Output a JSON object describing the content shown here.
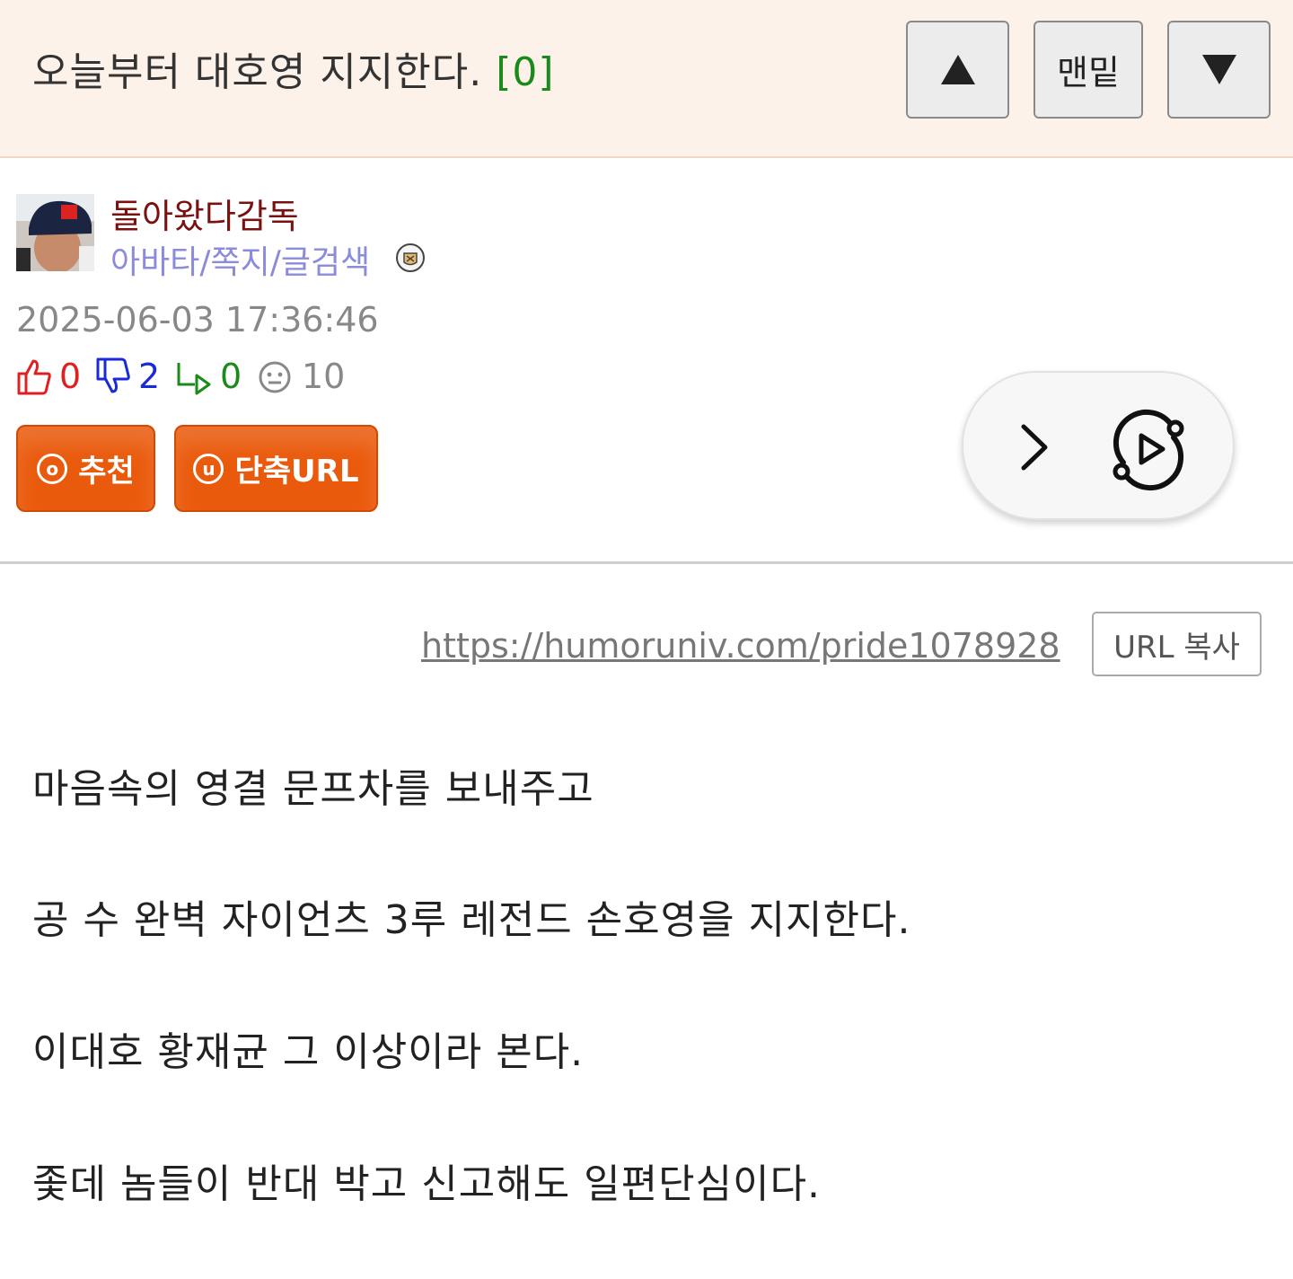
{
  "header": {
    "title": "오늘부터 대호영 지지한다.",
    "comment_count": "[0]",
    "up_icon": "triangle-up-icon",
    "bottom_label": "맨밑",
    "down_icon": "triangle-down-icon"
  },
  "author": {
    "name": "돌아왔다감독",
    "links": "아바타/쪽지/글검색",
    "badge_icon": "member-badge-icon"
  },
  "post": {
    "date": "2025-06-03 17:36:46",
    "stats": {
      "likes": "0",
      "dislikes": "2",
      "replies": "0",
      "views": "10"
    },
    "buttons": {
      "recommend": "추천",
      "recommend_symbol": "o",
      "short_url": "단축URL",
      "short_url_symbol": "u"
    },
    "url": "https://humoruniv.com/pride1078928",
    "copy_label": "URL 복사",
    "body": [
      "마음속의 영결 문프차를 보내주고",
      "공 수 완벽 자이언츠 3루 레전드 손호영을 지지한다.",
      "이대호 황재균 그 이상이라 본다.",
      "좇데 놈들이 반대 박고 신고해도 일편단심이다."
    ]
  },
  "colors": {
    "header_bg": "#fdf2e9",
    "author_name": "#7a1010",
    "author_links": "#8b8bdc",
    "like": "#e02020",
    "dislike": "#1a2ad8",
    "reply": "#1a8a1a",
    "button_orange": "#ea5a0c"
  },
  "floating": {
    "forward_icon": "chevron-right-icon",
    "play_icon": "replay-play-icon"
  }
}
